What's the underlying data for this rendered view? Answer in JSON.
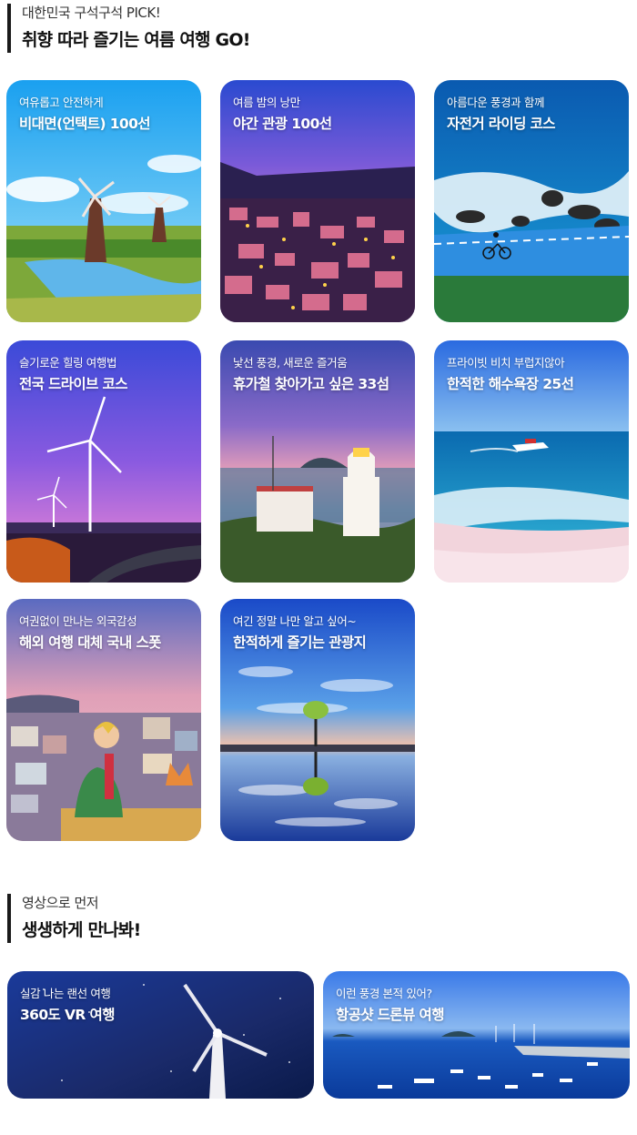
{
  "section1": {
    "subtitle": "대한민국 구석구석 PICK!",
    "title": "취향 따라 즐기는 여름 여행 GO!"
  },
  "cards": [
    {
      "subtitle": "여유롭고 안전하게",
      "title": "비대면(언택트) 100선"
    },
    {
      "subtitle": "여름 밤의 낭만",
      "title": "야간 관광 100선"
    },
    {
      "subtitle": "아름다운 풍경과 함께",
      "title": "자전거 라이딩 코스"
    },
    {
      "subtitle": "슬기로운 힐링 여행법",
      "title": "전국 드라이브 코스"
    },
    {
      "subtitle": "낯선 풍경, 새로운 즐거움",
      "title": "휴가철 찾아가고 싶은 33섬"
    },
    {
      "subtitle": "프라이빗 비치 부럽지않아",
      "title": "한적한 해수욕장 25선"
    },
    {
      "subtitle": "여권없이 만나는 외국감성",
      "title": "해외 여행 대체 국내 스폿"
    },
    {
      "subtitle": "여긴 정말 나만 알고 싶어~",
      "title": "한적하게 즐기는 관광지"
    }
  ],
  "section2": {
    "subtitle": "영상으로 먼저",
    "title": "생생하게 만나봐!"
  },
  "videos": [
    {
      "subtitle": "실감 나는 랜선 여행",
      "title": "360도 VR 여행"
    },
    {
      "subtitle": "이런 풍경 본적 있어?",
      "title": "항공샷 드론뷰 여행"
    }
  ]
}
